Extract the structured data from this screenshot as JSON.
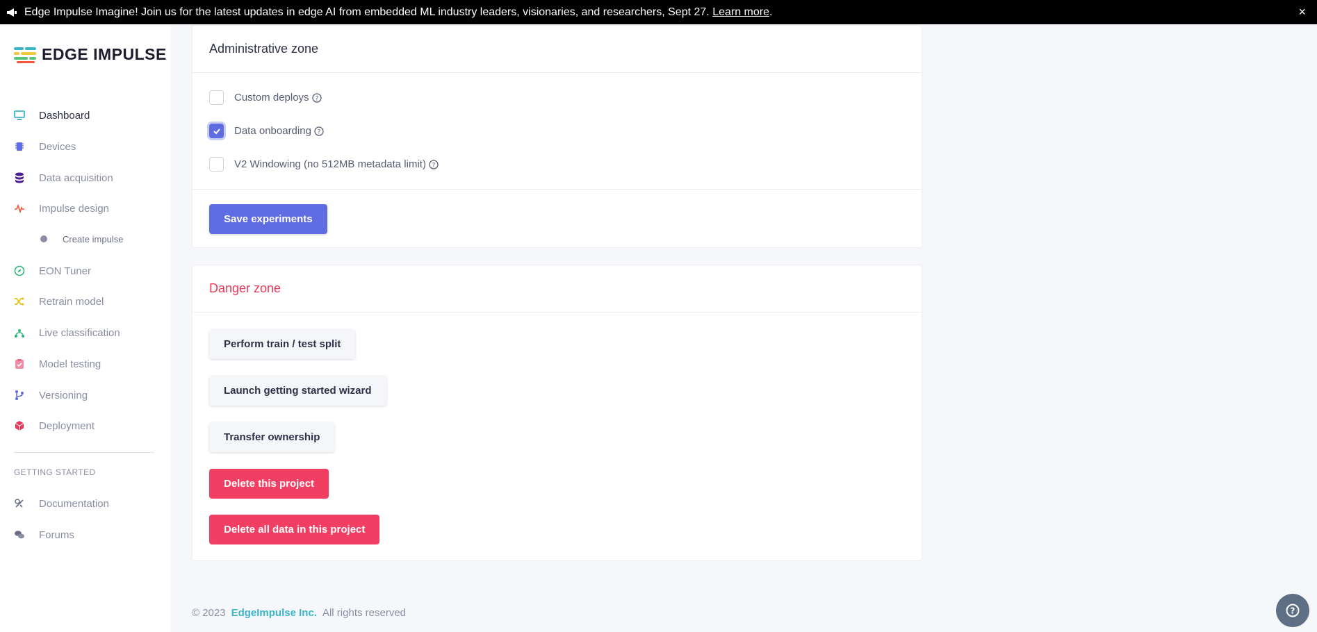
{
  "banner": {
    "text": "Edge Impulse Imagine! Join us for the latest updates in edge AI from embedded ML industry leaders, visionaries, and researchers, Sept 27.",
    "link": "Learn more",
    "tail": ".",
    "close": "×"
  },
  "brand": {
    "name": "EDGE IMPULSE"
  },
  "sidebar": {
    "items": [
      {
        "label": "Dashboard",
        "icon": "monitor-icon"
      },
      {
        "label": "Devices",
        "icon": "chip-icon"
      },
      {
        "label": "Data acquisition",
        "icon": "database-icon"
      },
      {
        "label": "Impulse design",
        "icon": "pulse-icon"
      },
      {
        "label": "Create impulse",
        "icon": "dot-icon"
      },
      {
        "label": "EON Tuner",
        "icon": "compass-icon"
      },
      {
        "label": "Retrain model",
        "icon": "shuffle-icon"
      },
      {
        "label": "Live classification",
        "icon": "nodes-icon"
      },
      {
        "label": "Model testing",
        "icon": "clipboard-check-icon"
      },
      {
        "label": "Versioning",
        "icon": "branch-icon"
      },
      {
        "label": "Deployment",
        "icon": "cube-icon"
      }
    ],
    "section_label": "GETTING STARTED",
    "help_items": [
      {
        "label": "Documentation",
        "icon": "doc-icon"
      },
      {
        "label": "Forums",
        "icon": "chat-icon"
      }
    ]
  },
  "admin": {
    "title": "Administrative zone",
    "options": [
      {
        "label": "Custom deploys",
        "checked": false
      },
      {
        "label": "Data onboarding",
        "checked": true
      },
      {
        "label": "V2 Windowing (no 512MB metadata limit)",
        "checked": false
      }
    ],
    "save_label": "Save experiments"
  },
  "danger": {
    "title": "Danger zone",
    "buttons": [
      "Perform train / test split",
      "Launch getting started wizard",
      "Transfer ownership",
      "Delete this project",
      "Delete all data in this project"
    ]
  },
  "footer": {
    "copyright": "© 2023",
    "company": "EdgeImpulse Inc.",
    "rights": "All rights reserved"
  },
  "colors": {
    "accent": "#5f6be0",
    "danger": "#f23e63",
    "link": "#3bb6c7"
  }
}
